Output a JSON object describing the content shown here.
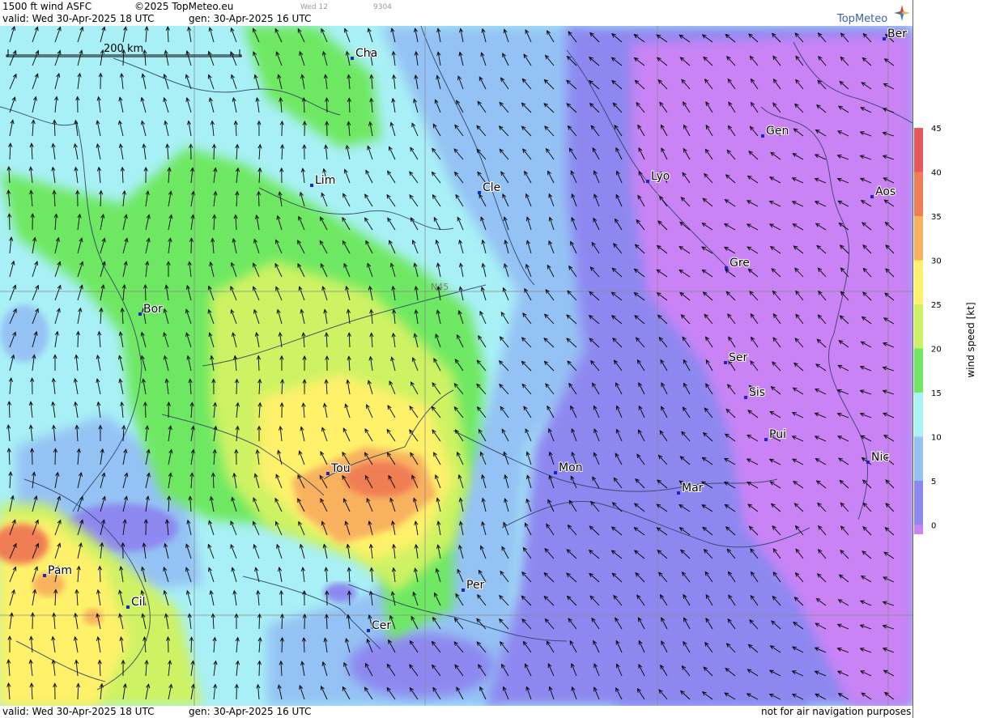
{
  "header": {
    "product": "1500 ft wind ASFC",
    "copyright": "©2025 TopMeteo.eu",
    "valid": "valid:  Wed  30-Apr-2025  18 UTC",
    "generated": "gen:  30-Apr-2025 16 UTC",
    "faint_day": "Wed 12",
    "faint_code": "9304"
  },
  "logo": {
    "text": "TopMeteo"
  },
  "scale_bar": {
    "label": "200 km"
  },
  "grid_label": "N45",
  "cities": [
    {
      "name": "Cha"
    },
    {
      "name": "Ber"
    },
    {
      "name": "Gen"
    },
    {
      "name": "Lyo"
    },
    {
      "name": "Lim"
    },
    {
      "name": "Cle"
    },
    {
      "name": "Aos"
    },
    {
      "name": "Gre"
    },
    {
      "name": "Bor"
    },
    {
      "name": "Ser"
    },
    {
      "name": "Sis"
    },
    {
      "name": "Pui"
    },
    {
      "name": "Tou"
    },
    {
      "name": "Mon"
    },
    {
      "name": "Nic"
    },
    {
      "name": "Mar"
    },
    {
      "name": "Pam"
    },
    {
      "name": "Per"
    },
    {
      "name": "Cil"
    },
    {
      "name": "Cer"
    }
  ],
  "legend": {
    "title": "wind  speed  [kt]",
    "ticks": [
      "45",
      "40",
      "35",
      "30",
      "25",
      "20",
      "15",
      "10",
      "5",
      "0"
    ],
    "colors": [
      "#e8585b",
      "#f07e55",
      "#f8b25e",
      "#fff16b",
      "#cdf263",
      "#6ee862",
      "#a8f3f6",
      "#94c2f4",
      "#8d88f0",
      "#c983f5"
    ]
  },
  "footer": {
    "valid": "valid:  Wed  30-Apr-2025  18 UTC",
    "generated": "gen:  30-Apr-2025 16 UTC",
    "disclaimer": "not for air navigation purposes"
  }
}
